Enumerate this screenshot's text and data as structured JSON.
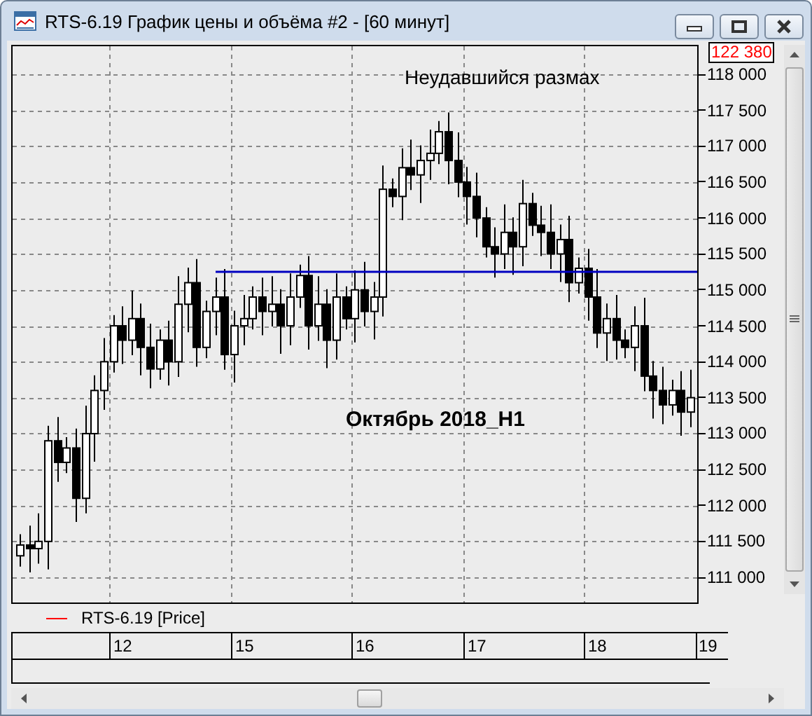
{
  "window": {
    "title": "RTS-6.19 График цены и объёма #2 - [60 минут]"
  },
  "chart": {
    "current_price": "122 380",
    "annotations": [
      {
        "kind": "plain",
        "text": "Неудавшийся размах"
      },
      {
        "kind": "bold",
        "text": "Октябрь 2018_H1"
      }
    ],
    "legend": {
      "text": "RTS-6.19 [Price]",
      "color": "#ff0000"
    },
    "chart_data": {
      "type": "candlestick",
      "categories": [
        null,
        null,
        null,
        null,
        null,
        null,
        null,
        null,
        null,
        null,
        null,
        "12",
        null,
        null,
        null,
        null,
        null,
        null,
        null,
        null,
        null,
        null,
        null,
        null,
        "15",
        null,
        null,
        null,
        null,
        null,
        null,
        null,
        null,
        null,
        null,
        null,
        null,
        "16",
        null,
        null,
        null,
        null,
        null,
        null,
        null,
        null,
        null,
        null,
        null,
        "17",
        null,
        null,
        null,
        null,
        null,
        null,
        null,
        null,
        null,
        null,
        null,
        null,
        "18",
        null,
        null,
        null,
        null,
        null,
        null,
        null,
        null,
        null,
        null,
        null,
        "19"
      ],
      "grid": true,
      "ref_lines": [
        {
          "axis": "y",
          "value": 115250,
          "color": "#0000c0"
        }
      ],
      "ohlc": [
        [
          111300,
          111600,
          111150,
          111450
        ],
        [
          111450,
          111720,
          111070,
          111400
        ],
        [
          111400,
          111890,
          111190,
          111500
        ],
        [
          111500,
          113110,
          111110,
          112900
        ],
        [
          112900,
          113230,
          112330,
          112600
        ],
        [
          112600,
          112950,
          112450,
          112800
        ],
        [
          112800,
          113070,
          111770,
          112100
        ],
        [
          112100,
          113390,
          111890,
          113000
        ],
        [
          113000,
          113810,
          112610,
          113600
        ],
        [
          113600,
          114330,
          113330,
          114000
        ],
        [
          114000,
          114650,
          113850,
          114500
        ],
        [
          114500,
          114770,
          113970,
          114300
        ],
        [
          114300,
          114990,
          114090,
          114600
        ],
        [
          114600,
          114810,
          113810,
          114200
        ],
        [
          114200,
          114530,
          113630,
          113900
        ],
        [
          113900,
          114450,
          113750,
          114300
        ],
        [
          114300,
          114570,
          113670,
          114000
        ],
        [
          114000,
          115190,
          113790,
          114800
        ],
        [
          114800,
          115310,
          114410,
          115100
        ],
        [
          115100,
          115430,
          113930,
          114200
        ],
        [
          114200,
          114850,
          114050,
          114700
        ],
        [
          114700,
          115170,
          114370,
          114900
        ],
        [
          114900,
          115290,
          113890,
          114100
        ],
        [
          114100,
          114710,
          113710,
          114500
        ],
        [
          114500,
          114930,
          114230,
          114600
        ],
        [
          114600,
          115050,
          114450,
          114900
        ],
        [
          114900,
          115170,
          114370,
          114700
        ],
        [
          114700,
          115190,
          114490,
          114800
        ],
        [
          114800,
          115010,
          114110,
          114500
        ],
        [
          114500,
          115230,
          114230,
          114900
        ],
        [
          114900,
          115350,
          114750,
          115200
        ],
        [
          115200,
          115470,
          114170,
          114500
        ],
        [
          114500,
          115190,
          114290,
          114800
        ],
        [
          114800,
          115010,
          113910,
          114300
        ],
        [
          114300,
          115230,
          114030,
          114900
        ],
        [
          114900,
          115050,
          114450,
          114600
        ],
        [
          114600,
          115270,
          114270,
          115000
        ],
        [
          115000,
          115390,
          114490,
          114700
        ],
        [
          114700,
          115110,
          114310,
          114900
        ],
        [
          114900,
          116730,
          114630,
          116400
        ],
        [
          116400,
          116550,
          116150,
          116300
        ],
        [
          116300,
          116970,
          115970,
          116700
        ],
        [
          116700,
          117090,
          116390,
          116600
        ],
        [
          116600,
          117010,
          116210,
          116800
        ],
        [
          116800,
          117230,
          116530,
          116900
        ],
        [
          116900,
          117350,
          116750,
          117200
        ],
        [
          117200,
          117470,
          116470,
          116800
        ],
        [
          116800,
          117190,
          116290,
          116500
        ],
        [
          116500,
          116710,
          115910,
          116300
        ],
        [
          116300,
          116630,
          115730,
          116000
        ],
        [
          116000,
          116150,
          115450,
          115600
        ],
        [
          115600,
          115870,
          115170,
          115500
        ],
        [
          115500,
          116190,
          115290,
          115800
        ],
        [
          115800,
          116010,
          115210,
          115600
        ],
        [
          115600,
          116530,
          115330,
          116200
        ],
        [
          116200,
          116350,
          115750,
          115900
        ],
        [
          115900,
          116170,
          115470,
          115800
        ],
        [
          115800,
          116190,
          115290,
          115500
        ],
        [
          115500,
          115910,
          115110,
          115700
        ],
        [
          115700,
          116030,
          114830,
          115100
        ],
        [
          115100,
          115450,
          114950,
          115300
        ],
        [
          115300,
          115570,
          114570,
          114900
        ],
        [
          114900,
          115290,
          114190,
          114400
        ],
        [
          114400,
          114810,
          114010,
          114600
        ],
        [
          114600,
          114930,
          114030,
          114300
        ],
        [
          114300,
          114450,
          114050,
          114200
        ],
        [
          114200,
          114770,
          113870,
          114500
        ],
        [
          114500,
          114890,
          113590,
          113800
        ],
        [
          113800,
          114010,
          113210,
          113600
        ],
        [
          113600,
          113930,
          113130,
          113400
        ],
        [
          113400,
          113750,
          113250,
          113600
        ],
        [
          113600,
          113870,
          112970,
          113300
        ],
        [
          113300,
          113890,
          113090,
          113500
        ],
        null,
        null
      ],
      "ylim": [
        110650,
        118390
      ],
      "yticks": [
        {
          "value": 118000,
          "label": "118 000"
        },
        {
          "value": 117500,
          "label": "117 500"
        },
        {
          "value": 117000,
          "label": "117 000"
        },
        {
          "value": 116500,
          "label": "116 500"
        },
        {
          "value": 116000,
          "label": "116 000"
        },
        {
          "value": 115500,
          "label": "115 500"
        },
        {
          "value": 115000,
          "label": "115 000"
        },
        {
          "value": 114500,
          "label": "114 500"
        },
        {
          "value": 114000,
          "label": "114 000"
        },
        {
          "value": 113500,
          "label": "113 500"
        },
        {
          "value": 113000,
          "label": "113 000"
        },
        {
          "value": 112500,
          "label": "112 500"
        },
        {
          "value": 112000,
          "label": "112 000"
        },
        {
          "value": 111500,
          "label": "111 500"
        },
        {
          "value": 111000,
          "label": "111 000"
        }
      ]
    }
  }
}
